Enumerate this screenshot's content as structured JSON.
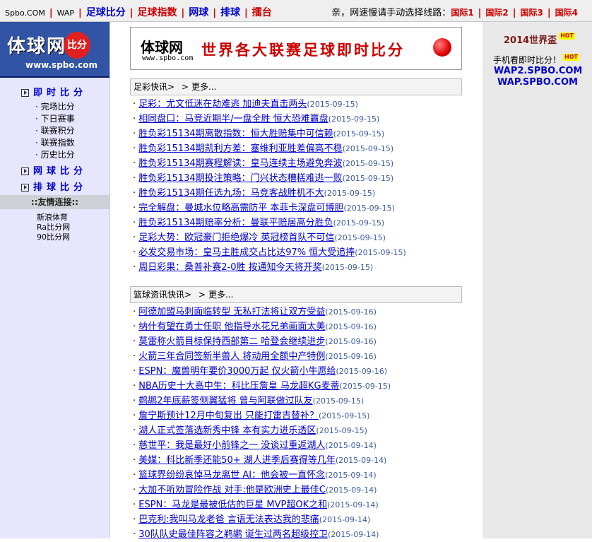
{
  "topnav": {
    "site": "Spbo.COM",
    "wap": "WAP",
    "links": [
      "足球比分",
      "足球指数",
      "网球",
      "排球",
      "擂台"
    ],
    "notice": "亲，网速慢请手动选择线路：",
    "lines": [
      "国际1",
      "国际2",
      "国际3",
      "国际4"
    ]
  },
  "logo": {
    "name": "体球网",
    "badge": "比分",
    "url": "www.spbo.com"
  },
  "menu": {
    "live": "即时比分",
    "live_sub": [
      "完场比分",
      "下日赛事",
      "联赛积分",
      "联赛指数",
      "历史比分"
    ],
    "tennis": "网球比分",
    "volley": "排球比分"
  },
  "friends": {
    "title": "::友情连接::",
    "links": [
      "新浪体育",
      "Ra比分网",
      "90比分网"
    ]
  },
  "right": {
    "worldcup": "2014世界盃",
    "hot": "HOT",
    "mobile": "手机看即时比分！",
    "wap2": "WAP2.SPBO.COM",
    "wap": "WAP.SPBO.COM"
  },
  "banner": {
    "name": "体球网",
    "url": "www.spbo.com",
    "slogan": "世界各大联赛足球即时比分"
  },
  "football": {
    "title": "足彩快讯",
    "more": "更多...",
    "items": [
      {
        "t": "足彩：尤文低迷在劫难逃 加迪夫直击两头",
        "d": "(2015-09-15)"
      },
      {
        "t": "相同盘口：马竞近期半/一盘全胜 恒大恐难赢盘",
        "d": "(2015-09-15)"
      },
      {
        "t": "胜负彩15134期离散指数：恒大胜赔集中可信赖",
        "d": "(2015-09-15)"
      },
      {
        "t": "胜负彩15134期凯利方差：塞维利亚胜差偏高不稳",
        "d": "(2015-09-15)"
      },
      {
        "t": "胜负彩15134期赛程解读：皇马连续主场避免奔波",
        "d": "(2015-09-15)"
      },
      {
        "t": "胜负彩15134期投注策略：门兴状态糟糕难逃一败",
        "d": "(2015-09-15)"
      },
      {
        "t": "胜负彩15134期任选九场：马竞客战胜机不大",
        "d": "(2015-09-15)"
      },
      {
        "t": "完全解盘：曼城水位略高需防平 本菲卡深盘可博胆",
        "d": "(2015-09-15)"
      },
      {
        "t": "胜负彩15134期赔率分析：曼联平赔居高分胜负",
        "d": "(2015-09-15)"
      },
      {
        "t": "足彩大势：欧冠豪门拒绝爆冷 英冠榜首队不可信",
        "d": "(2015-09-15)"
      },
      {
        "t": "必发交易市场：皇马主胜成交占比达97% 恒大受追捧",
        "d": "(2015-09-15)"
      },
      {
        "t": "周日彩果：桑普补赛2-0胜 按通知今天将开奖",
        "d": "(2015-09-15)"
      }
    ]
  },
  "basketball": {
    "title": "篮球资讯快讯",
    "more": "更多...",
    "items": [
      {
        "t": "阿德加盟马刺面临转型 无私打法将让双方受益",
        "d": "(2015-09-16)"
      },
      {
        "t": "纳什有望在勇士任职 他指导水花兄弟画面太美",
        "d": "(2015-09-16)"
      },
      {
        "t": "莫雷称火箭目标保持西部第二 哈登会继续进步",
        "d": "(2015-09-16)"
      },
      {
        "t": "火箭三年合同签新半兽人 将动用全额中产特例",
        "d": "(2015-09-16)"
      },
      {
        "t": "ESPN：魔兽明年要价3000万起 仅火箭小牛愿给",
        "d": "(2015-09-16)"
      },
      {
        "t": "NBA历史十大高中生：科比压詹皇 马龙超KG麦蒂",
        "d": "(2015-09-15)"
      },
      {
        "t": "鹈鹕2年底薪签侧翼猛将 曾与阿联做过队友",
        "d": "(2015-09-15)"
      },
      {
        "t": "詹宁斯预计12月中旬复出 只能打雷吉替补？",
        "d": "(2015-09-15)"
      },
      {
        "t": "湖人正式签落选新秀中锋 本有实力进乐透区",
        "d": "(2015-09-15)"
      },
      {
        "t": "慈世平：我是最好小前锋之一 没谈过重返湖人",
        "d": "(2015-09-14)"
      },
      {
        "t": "美媒：科比新季还能50+ 湖人进季后赛得等几年",
        "d": "(2015-09-14)"
      },
      {
        "t": "篮球界纷纷哀悼马龙离世 AI：他会被一直怀念",
        "d": "(2015-09-14)"
      },
      {
        "t": "大加不听劝冒险作战 对手:他是欧洲史上最佳C",
        "d": "(2015-09-14)"
      },
      {
        "t": "ESPN：马龙是最被低估的巨星 MVP超OK之和",
        "d": "(2015-09-14)"
      },
      {
        "t": "巴克利:我叫马龙老爸 言语无法表达我的悲痛",
        "d": "(2015-09-14)"
      },
      {
        "t": "30队队史最佳阵容之鹈鹕 诞生过两名超级控卫",
        "d": "(2015-09-14)"
      }
    ]
  }
}
